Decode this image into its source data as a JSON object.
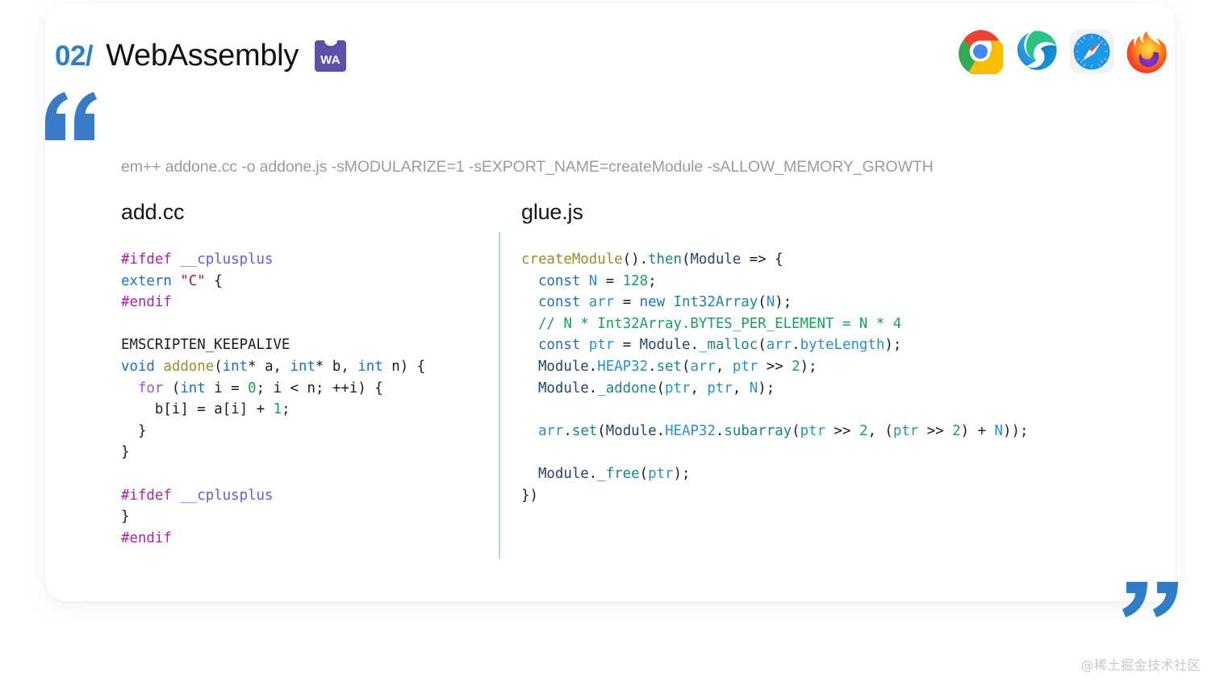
{
  "slide": {
    "number": "02/",
    "title": "WebAssembly",
    "badge_text": "WA",
    "badge_color": "#5b51a8",
    "number_color": "#2f7fc6",
    "quote_color": "#3a7bc8"
  },
  "browsers": [
    {
      "name": "chrome-logo",
      "label": "Chrome"
    },
    {
      "name": "edge-logo",
      "label": "Edge"
    },
    {
      "name": "safari-logo",
      "label": "Safari"
    },
    {
      "name": "firefox-logo",
      "label": "Firefox"
    }
  ],
  "command": "em++ addone.cc -o addone.js -sMODULARIZE=1 -sEXPORT_NAME=createModule -sALLOW_MEMORY_GROWTH",
  "panels": {
    "left": {
      "title": "add.cc",
      "language": "cpp",
      "lines": [
        "#ifdef __cplusplus",
        "extern \"C\" {",
        "#endif",
        "",
        "EMSCRIPTEN_KEEPALIVE",
        "void addone(int* a, int* b, int n) {",
        "  for (int i = 0; i < n; ++i) {",
        "    b[i] = a[i] + 1;",
        "  }",
        "}",
        "",
        "#ifdef __cplusplus",
        "}",
        "#endif"
      ]
    },
    "right": {
      "title": "glue.js",
      "language": "javascript",
      "lines": [
        "createModule().then(Module => {",
        "  const N = 128;",
        "  const arr = new Int32Array(N);",
        "  // N * Int32Array.BYTES_PER_ELEMENT = N * 4",
        "  const ptr = Module._malloc(arr.byteLength);",
        "  Module.HEAP32.set(arr, ptr >> 2);",
        "  Module._addone(ptr, ptr, N);",
        "",
        "  arr.set(Module.HEAP32.subarray(ptr >> 2, (ptr >> 2) + N));",
        "",
        "  Module._free(ptr);",
        "})"
      ]
    }
  },
  "watermark": "@稀土掘金技术社区"
}
